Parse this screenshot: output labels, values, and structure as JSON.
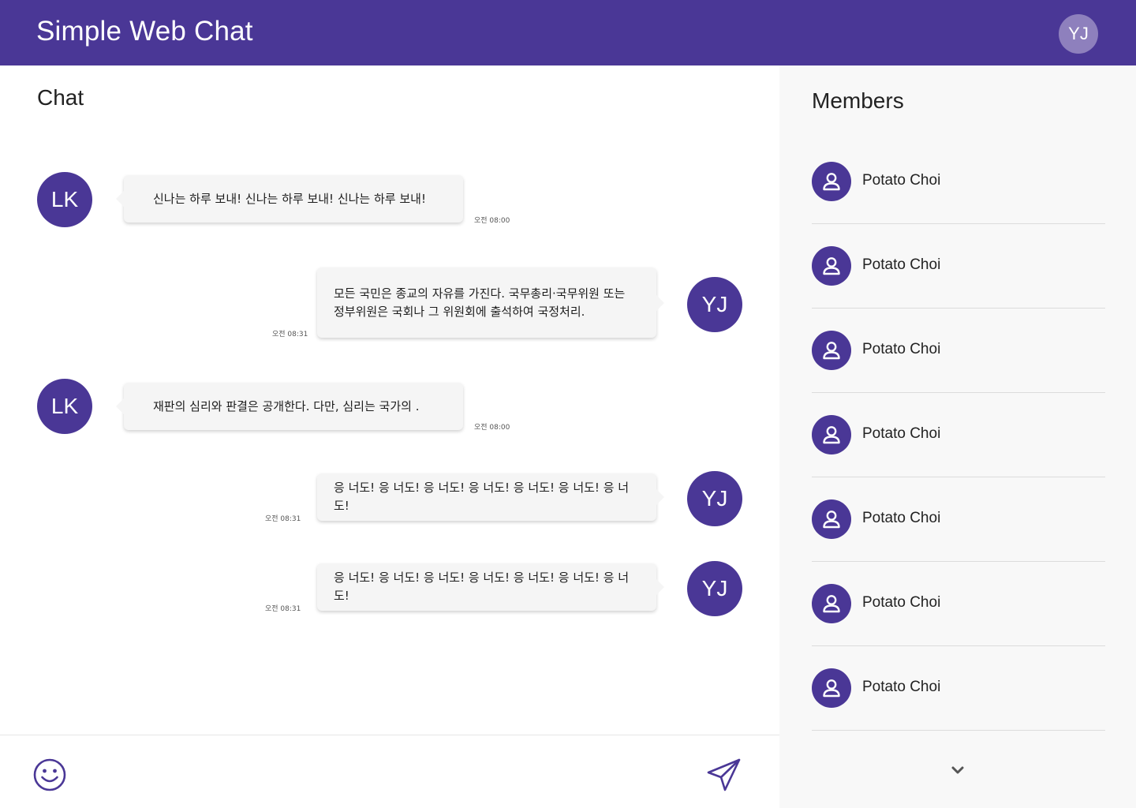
{
  "header": {
    "title": "Simple Web Chat",
    "user_initials": "YJ",
    "brand_color": "#4a3796"
  },
  "chat": {
    "title": "Chat",
    "messages": [
      {
        "sender": "LK",
        "side": "left",
        "text": "신나는 하루 보내! 신나는 하루 보내! 신나는 하루 보내!",
        "time": "오전 08:00"
      },
      {
        "sender": "YJ",
        "side": "right",
        "text": "모든 국민은 종교의 자유를 가진다. 국무총리·국무위원 또는 정부위원은 국회나 그 위원회에 출석하여 국정처리.",
        "time": "오전 08:31"
      },
      {
        "sender": "LK",
        "side": "left",
        "text": "재판의 심리와 판결은 공개한다. 다만, 심리는 국가의 .",
        "time": "오전 08:00"
      },
      {
        "sender": "YJ",
        "side": "right",
        "text": "응 너도! 응 너도! 응 너도! 응 너도! 응 너도! 응 너도! 응 너도!",
        "time": "오전 08:31"
      },
      {
        "sender": "YJ",
        "side": "right",
        "text": "응 너도! 응 너도! 응 너도! 응 너도! 응 너도! 응 너도! 응 너도!",
        "time": "오전 08:31"
      }
    ]
  },
  "composer": {
    "emoji_icon": "smiley-face-icon",
    "send_icon": "paper-plane-icon"
  },
  "members": {
    "title": "Members",
    "items": [
      {
        "name": "Potato Choi",
        "icon": "user-icon"
      },
      {
        "name": "Potato Choi",
        "icon": "user-icon"
      },
      {
        "name": "Potato Choi",
        "icon": "user-icon"
      },
      {
        "name": "Potato Choi",
        "icon": "user-icon"
      },
      {
        "name": "Potato Choi",
        "icon": "user-icon"
      },
      {
        "name": "Potato Choi",
        "icon": "user-icon"
      },
      {
        "name": "Potato Choi",
        "icon": "user-icon"
      }
    ],
    "more_icon": "chevron-down-icon"
  }
}
